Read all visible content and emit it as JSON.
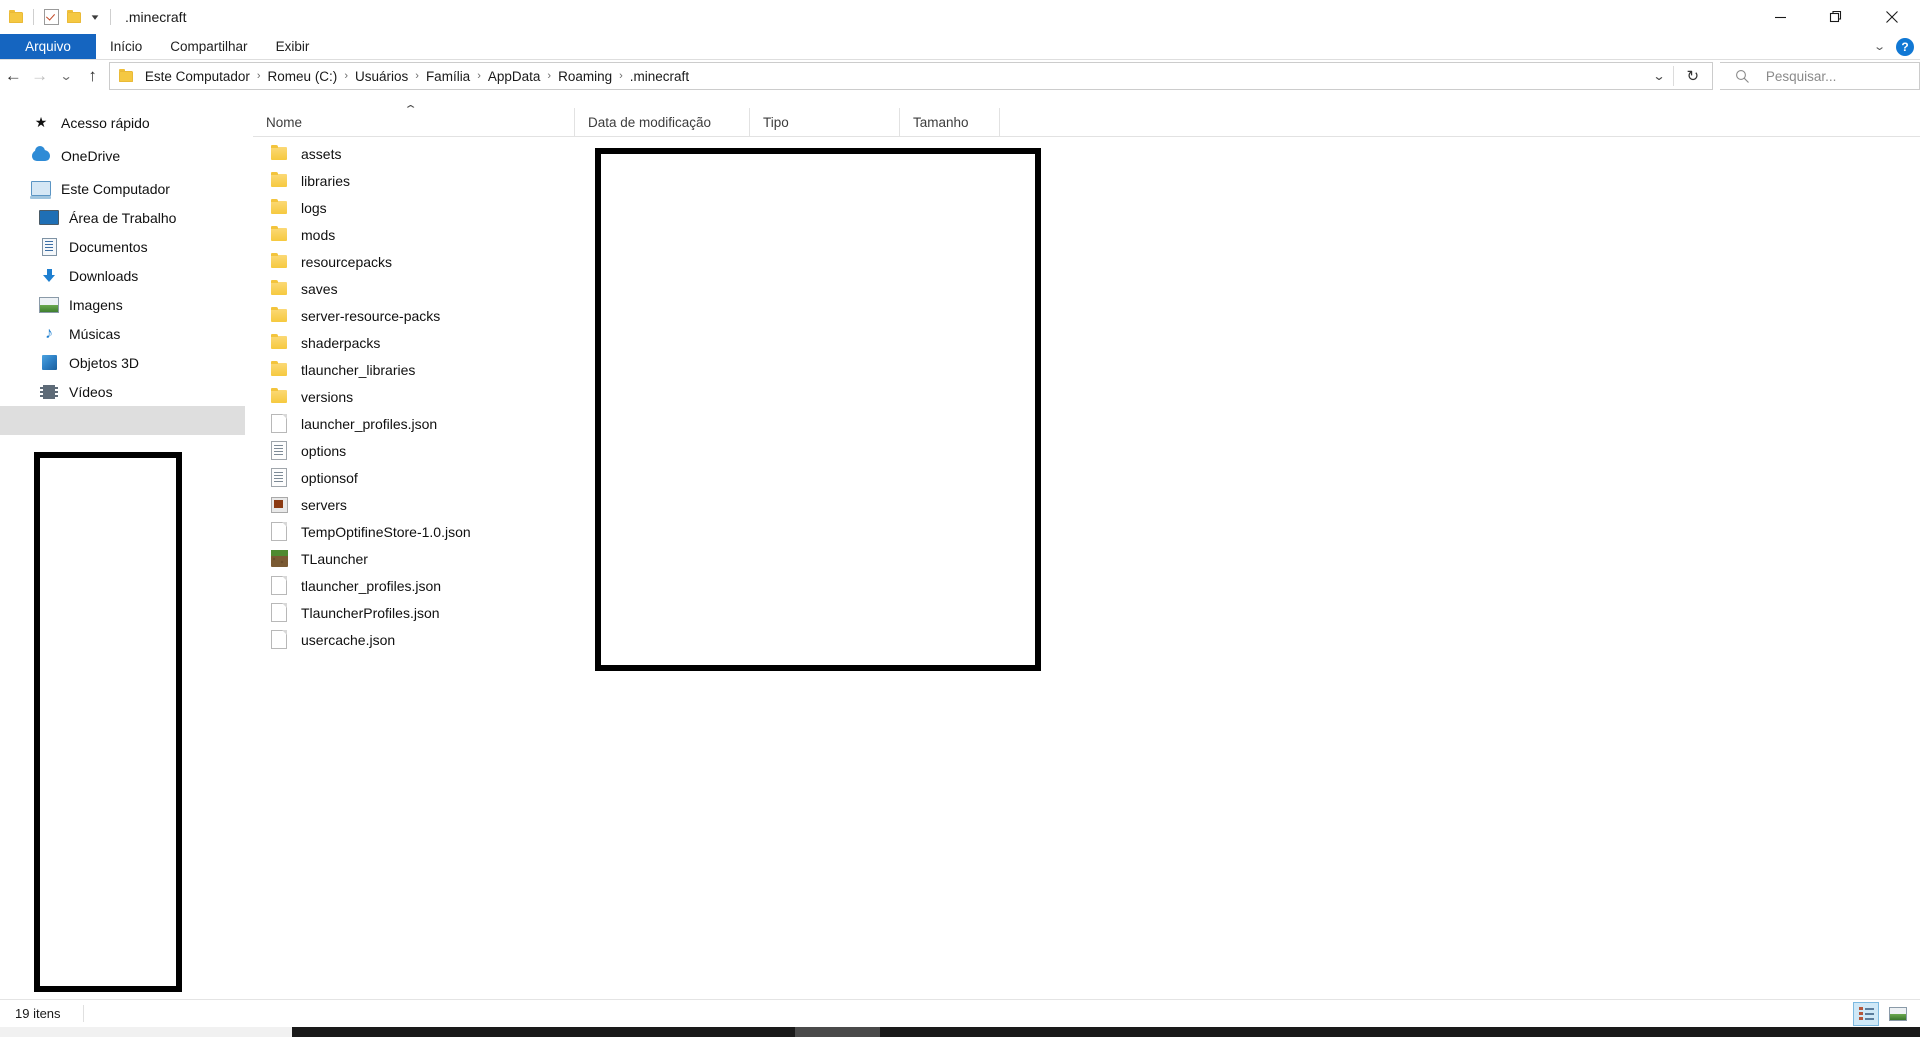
{
  "window": {
    "title": ".minecraft",
    "quick_access": {
      "folder_icon": "folder-icon",
      "properties_icon": "checkbox-properties-icon",
      "new_folder_icon": "new-folder-icon",
      "customize_caret": "▾"
    },
    "controls": {
      "minimize": "minimize-icon",
      "maximize": "maximize-icon",
      "close": "close-icon"
    }
  },
  "ribbon": {
    "tabs": [
      {
        "label": "Arquivo",
        "active": true
      },
      {
        "label": "Início",
        "active": false
      },
      {
        "label": "Compartilhar",
        "active": false
      },
      {
        "label": "Exibir",
        "active": false
      }
    ],
    "collapse_caret": "⌄",
    "help_label": "?"
  },
  "address": {
    "nav": {
      "back": "←",
      "forward": "→",
      "recent": "⌄",
      "up": "↑"
    },
    "folder_icon": "folder-icon",
    "breadcrumbs": [
      "Este Computador",
      "Romeu (C:)",
      "Usuários",
      "Família",
      "AppData",
      "Roaming",
      ".minecraft"
    ],
    "separator": "›",
    "dropdown_caret": "⌄",
    "refresh_icon": "↻",
    "search": {
      "icon": "search-icon",
      "placeholder": "Pesquisar..."
    }
  },
  "navpane": {
    "items": [
      {
        "label": "Acesso rápido",
        "icon": "star-icon",
        "level": 0,
        "selected": false
      },
      {
        "label": "OneDrive",
        "icon": "cloud-icon",
        "level": 0,
        "selected": false
      },
      {
        "label": "Este Computador",
        "icon": "computer-icon",
        "level": 0,
        "selected": false
      },
      {
        "label": "Área de Trabalho",
        "icon": "desktop-icon",
        "level": 1,
        "selected": false
      },
      {
        "label": "Documentos",
        "icon": "documents-icon",
        "level": 1,
        "selected": false
      },
      {
        "label": "Downloads",
        "icon": "downloads-icon",
        "level": 1,
        "selected": false
      },
      {
        "label": "Imagens",
        "icon": "pictures-icon",
        "level": 1,
        "selected": false
      },
      {
        "label": "Músicas",
        "icon": "music-icon",
        "level": 1,
        "selected": false
      },
      {
        "label": "Objetos 3D",
        "icon": "objects3d-icon",
        "level": 1,
        "selected": false
      },
      {
        "label": "Vídeos",
        "icon": "videos-icon",
        "level": 1,
        "selected": false
      },
      {
        "label": "",
        "icon": "none",
        "level": 1,
        "selected": true
      }
    ]
  },
  "filelist": {
    "columns": [
      {
        "label": "Nome",
        "sorted": true,
        "sort_caret": "⌃"
      },
      {
        "label": "Data de modificação",
        "sorted": false
      },
      {
        "label": "Tipo",
        "sorted": false
      },
      {
        "label": "Tamanho",
        "sorted": false
      }
    ],
    "rows": [
      {
        "name": "assets",
        "icon": "folder-icon",
        "date": "",
        "type": "",
        "size": ""
      },
      {
        "name": "libraries",
        "icon": "folder-icon",
        "date": "",
        "type": "",
        "size": ""
      },
      {
        "name": "logs",
        "icon": "folder-icon",
        "date": "",
        "type": "",
        "size": ""
      },
      {
        "name": "mods",
        "icon": "folder-icon",
        "date": "",
        "type": "",
        "size": ""
      },
      {
        "name": "resourcepacks",
        "icon": "folder-icon",
        "date": "",
        "type": "",
        "size": ""
      },
      {
        "name": "saves",
        "icon": "folder-icon",
        "date": "",
        "type": "",
        "size": ""
      },
      {
        "name": "server-resource-packs",
        "icon": "folder-icon",
        "date": "",
        "type": "",
        "size": ""
      },
      {
        "name": "shaderpacks",
        "icon": "folder-icon",
        "date": "",
        "type": "",
        "size": ""
      },
      {
        "name": "tlauncher_libraries",
        "icon": "folder-icon",
        "date": "",
        "type": "",
        "size": ""
      },
      {
        "name": "versions",
        "icon": "folder-icon",
        "date": "",
        "type": "",
        "size": ""
      },
      {
        "name": "launcher_profiles.json",
        "icon": "json-file-icon",
        "date": "",
        "type": "",
        "size": ""
      },
      {
        "name": "options",
        "icon": "text-file-icon",
        "date": "",
        "type": "",
        "size": ""
      },
      {
        "name": "optionsof",
        "icon": "text-file-icon",
        "date": "",
        "type": "",
        "size": ""
      },
      {
        "name": "servers",
        "icon": "dat-file-icon",
        "date": "",
        "type": "",
        "size": ""
      },
      {
        "name": "TempOptifineStore-1.0.json",
        "icon": "json-file-icon",
        "date": "",
        "type": "",
        "size": ""
      },
      {
        "name": "TLauncher",
        "icon": "minecraft-icon",
        "date": "",
        "type": "",
        "size": ""
      },
      {
        "name": "tlauncher_profiles.json",
        "icon": "json-file-icon",
        "date": "",
        "type": "",
        "size": ""
      },
      {
        "name": "TlauncherProfiles.json",
        "icon": "json-file-icon",
        "date": "",
        "type": "",
        "size": ""
      },
      {
        "name": "usercache.json",
        "icon": "json-file-icon",
        "date": "",
        "type": "",
        "size": ""
      }
    ]
  },
  "statusbar": {
    "item_count": "19 itens",
    "views": [
      {
        "name": "details-view-icon",
        "active": true
      },
      {
        "name": "thumbnails-view-icon",
        "active": false
      }
    ]
  },
  "colors": {
    "accent": "#1565c0",
    "selection": "#dedede",
    "folder": "#f5c842",
    "annotation": "#000000"
  }
}
